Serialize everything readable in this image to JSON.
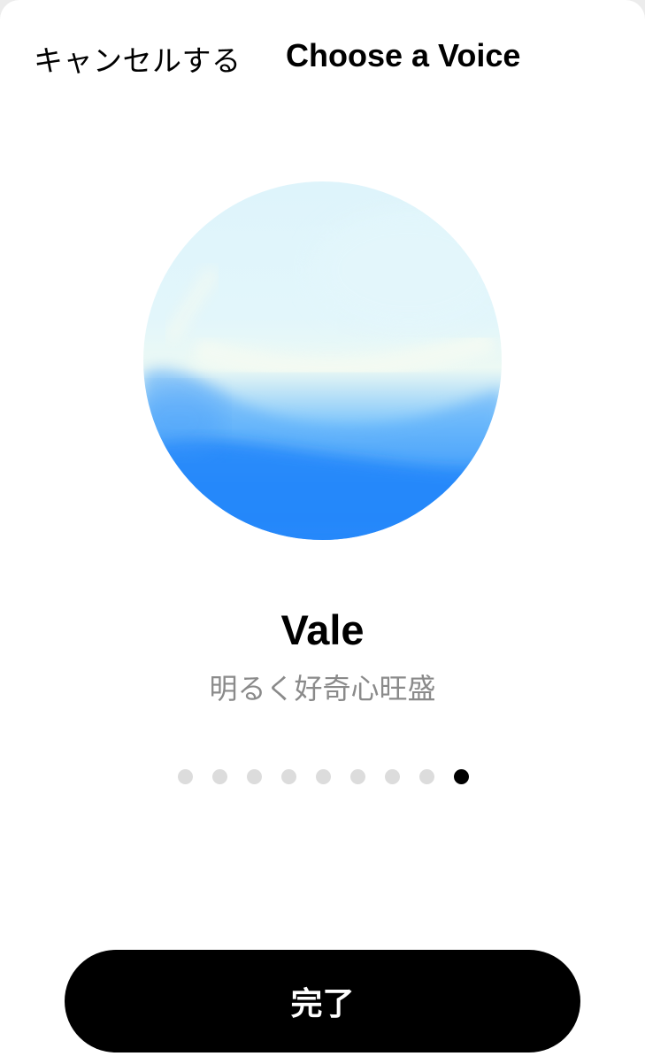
{
  "header": {
    "cancel_label": "キャンセルする",
    "title": "Choose a Voice"
  },
  "voice": {
    "name": "Vale",
    "description": "明るく好奇心旺盛",
    "orb_colors": [
      "#def4fb",
      "#ecf9f4",
      "#7ec5fb",
      "#1a7ffa"
    ]
  },
  "pager": {
    "total": 9,
    "active_index": 9
  },
  "footer": {
    "done_label": "完了"
  }
}
